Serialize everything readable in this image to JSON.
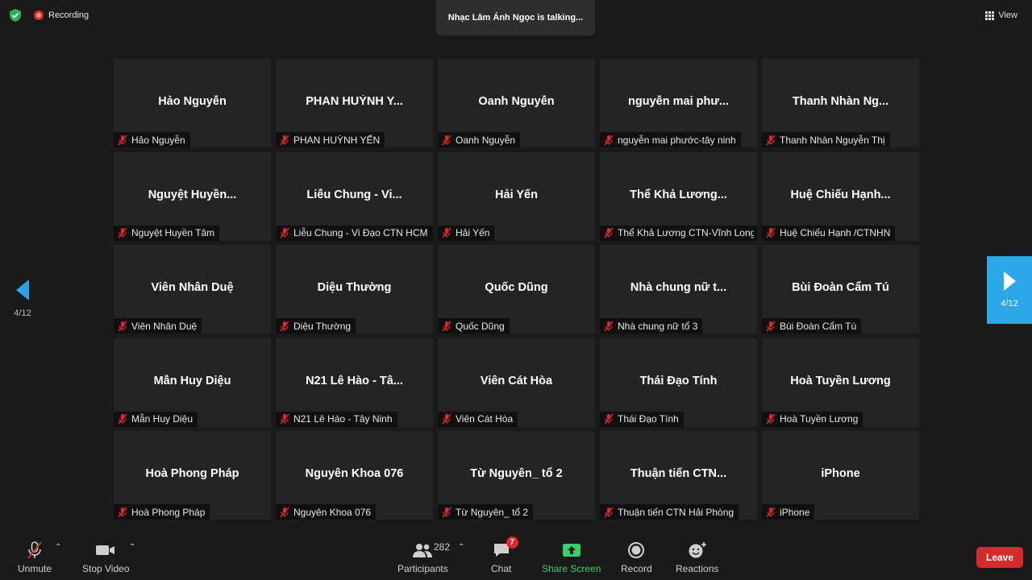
{
  "top": {
    "recording_label": "Recording",
    "talking_text": "Nhạc Lâm Ánh Ngọc is talking...",
    "view_label": "View"
  },
  "nav": {
    "prev_page": "4/12",
    "next_page": "4/12"
  },
  "participants": [
    {
      "display": "Hảo Nguyễn",
      "label": "Hảo Nguyễn"
    },
    {
      "display": "PHAN HUỲNH Y...",
      "label": "PHAN HUỲNH YẾN"
    },
    {
      "display": "Oanh Nguyễn",
      "label": "Oanh Nguyễn"
    },
    {
      "display": "nguyễn mai phư...",
      "label": "nguyễn mai phước-tây ninh"
    },
    {
      "display": "Thanh Nhàn Ng...",
      "label": "Thanh Nhàn Nguyễn Thị"
    },
    {
      "display": "Nguyệt  Huyền...",
      "label": "Nguyệt  Huyền  Tâm"
    },
    {
      "display": "Liễu Chung - Vi...",
      "label": "Liễu Chung - Vi Đạo CTN HCM"
    },
    {
      "display": "Hải Yến",
      "label": "Hải Yến"
    },
    {
      "display": "Thể Khả Lương...",
      "label": "Thể Khả Lương CTN-Vĩnh Long"
    },
    {
      "display": "Huệ  Chiếu  Hạnh...",
      "label": "Huệ Chiếu Hạnh /CTNHN"
    },
    {
      "display": "Viên Nhân Duệ",
      "label": "Viên Nhân Duệ"
    },
    {
      "display": "Diệu Thường",
      "label": "Diệu Thường"
    },
    {
      "display": "Quốc Dũng",
      "label": "Quốc Dũng"
    },
    {
      "display": "Nhà chung nữ t...",
      "label": "Nhà chung nữ tổ 3"
    },
    {
      "display": "Bùi Đoàn Cẩm Tú",
      "label": "Bùi Đoàn Cẩm Tú"
    },
    {
      "display": "Mẫn Huy Diệu",
      "label": "Mẫn Huy Diệu"
    },
    {
      "display": "N21 Lê Hào - Tâ...",
      "label": "N21 Lê Hào - Tây Ninh"
    },
    {
      "display": "Viên Cát Hòa",
      "label": "Viên Cát Hòa"
    },
    {
      "display": "Thái Đạo Tính",
      "label": "Thái Đạo Tính"
    },
    {
      "display": "Hoà Tuyền Lương",
      "label": "Hoà Tuyền Lương"
    },
    {
      "display": "Hoà Phong Pháp",
      "label": "Hoà Phong Pháp"
    },
    {
      "display": "Nguyên Khoa 076",
      "label": "Nguyên Khoa 076"
    },
    {
      "display": "Từ Nguyên_ tổ 2",
      "label": "Từ Nguyên_ tổ 2"
    },
    {
      "display": "Thuận tiến CTN...",
      "label": "Thuận tiến CTN Hải Phòng"
    },
    {
      "display": "iPhone",
      "label": "iPhone"
    }
  ],
  "toolbar": {
    "unmute": "Unmute",
    "stop_video": "Stop Video",
    "participants": "Participants",
    "participants_count": "282",
    "chat": "Chat",
    "chat_badge": "7",
    "share_screen": "Share Screen",
    "record": "Record",
    "reactions": "Reactions",
    "leave": "Leave"
  },
  "colors": {
    "accent": "#2aa7e8",
    "share": "#36d06a",
    "leave": "#d42a2a",
    "mic_off": "#e02828"
  }
}
